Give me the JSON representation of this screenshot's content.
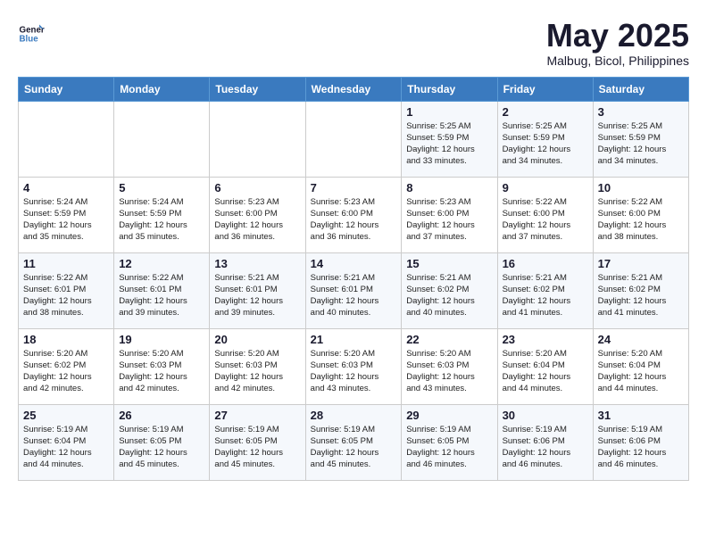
{
  "header": {
    "logo_line1": "General",
    "logo_line2": "Blue",
    "month": "May 2025",
    "location": "Malbug, Bicol, Philippines"
  },
  "days_of_week": [
    "Sunday",
    "Monday",
    "Tuesday",
    "Wednesday",
    "Thursday",
    "Friday",
    "Saturday"
  ],
  "weeks": [
    [
      {
        "day": "",
        "info": ""
      },
      {
        "day": "",
        "info": ""
      },
      {
        "day": "",
        "info": ""
      },
      {
        "day": "",
        "info": ""
      },
      {
        "day": "1",
        "info": "Sunrise: 5:25 AM\nSunset: 5:59 PM\nDaylight: 12 hours\nand 33 minutes."
      },
      {
        "day": "2",
        "info": "Sunrise: 5:25 AM\nSunset: 5:59 PM\nDaylight: 12 hours\nand 34 minutes."
      },
      {
        "day": "3",
        "info": "Sunrise: 5:25 AM\nSunset: 5:59 PM\nDaylight: 12 hours\nand 34 minutes."
      }
    ],
    [
      {
        "day": "4",
        "info": "Sunrise: 5:24 AM\nSunset: 5:59 PM\nDaylight: 12 hours\nand 35 minutes."
      },
      {
        "day": "5",
        "info": "Sunrise: 5:24 AM\nSunset: 5:59 PM\nDaylight: 12 hours\nand 35 minutes."
      },
      {
        "day": "6",
        "info": "Sunrise: 5:23 AM\nSunset: 6:00 PM\nDaylight: 12 hours\nand 36 minutes."
      },
      {
        "day": "7",
        "info": "Sunrise: 5:23 AM\nSunset: 6:00 PM\nDaylight: 12 hours\nand 36 minutes."
      },
      {
        "day": "8",
        "info": "Sunrise: 5:23 AM\nSunset: 6:00 PM\nDaylight: 12 hours\nand 37 minutes."
      },
      {
        "day": "9",
        "info": "Sunrise: 5:22 AM\nSunset: 6:00 PM\nDaylight: 12 hours\nand 37 minutes."
      },
      {
        "day": "10",
        "info": "Sunrise: 5:22 AM\nSunset: 6:00 PM\nDaylight: 12 hours\nand 38 minutes."
      }
    ],
    [
      {
        "day": "11",
        "info": "Sunrise: 5:22 AM\nSunset: 6:01 PM\nDaylight: 12 hours\nand 38 minutes."
      },
      {
        "day": "12",
        "info": "Sunrise: 5:22 AM\nSunset: 6:01 PM\nDaylight: 12 hours\nand 39 minutes."
      },
      {
        "day": "13",
        "info": "Sunrise: 5:21 AM\nSunset: 6:01 PM\nDaylight: 12 hours\nand 39 minutes."
      },
      {
        "day": "14",
        "info": "Sunrise: 5:21 AM\nSunset: 6:01 PM\nDaylight: 12 hours\nand 40 minutes."
      },
      {
        "day": "15",
        "info": "Sunrise: 5:21 AM\nSunset: 6:02 PM\nDaylight: 12 hours\nand 40 minutes."
      },
      {
        "day": "16",
        "info": "Sunrise: 5:21 AM\nSunset: 6:02 PM\nDaylight: 12 hours\nand 41 minutes."
      },
      {
        "day": "17",
        "info": "Sunrise: 5:21 AM\nSunset: 6:02 PM\nDaylight: 12 hours\nand 41 minutes."
      }
    ],
    [
      {
        "day": "18",
        "info": "Sunrise: 5:20 AM\nSunset: 6:02 PM\nDaylight: 12 hours\nand 42 minutes."
      },
      {
        "day": "19",
        "info": "Sunrise: 5:20 AM\nSunset: 6:03 PM\nDaylight: 12 hours\nand 42 minutes."
      },
      {
        "day": "20",
        "info": "Sunrise: 5:20 AM\nSunset: 6:03 PM\nDaylight: 12 hours\nand 42 minutes."
      },
      {
        "day": "21",
        "info": "Sunrise: 5:20 AM\nSunset: 6:03 PM\nDaylight: 12 hours\nand 43 minutes."
      },
      {
        "day": "22",
        "info": "Sunrise: 5:20 AM\nSunset: 6:03 PM\nDaylight: 12 hours\nand 43 minutes."
      },
      {
        "day": "23",
        "info": "Sunrise: 5:20 AM\nSunset: 6:04 PM\nDaylight: 12 hours\nand 44 minutes."
      },
      {
        "day": "24",
        "info": "Sunrise: 5:20 AM\nSunset: 6:04 PM\nDaylight: 12 hours\nand 44 minutes."
      }
    ],
    [
      {
        "day": "25",
        "info": "Sunrise: 5:19 AM\nSunset: 6:04 PM\nDaylight: 12 hours\nand 44 minutes."
      },
      {
        "day": "26",
        "info": "Sunrise: 5:19 AM\nSunset: 6:05 PM\nDaylight: 12 hours\nand 45 minutes."
      },
      {
        "day": "27",
        "info": "Sunrise: 5:19 AM\nSunset: 6:05 PM\nDaylight: 12 hours\nand 45 minutes."
      },
      {
        "day": "28",
        "info": "Sunrise: 5:19 AM\nSunset: 6:05 PM\nDaylight: 12 hours\nand 45 minutes."
      },
      {
        "day": "29",
        "info": "Sunrise: 5:19 AM\nSunset: 6:05 PM\nDaylight: 12 hours\nand 46 minutes."
      },
      {
        "day": "30",
        "info": "Sunrise: 5:19 AM\nSunset: 6:06 PM\nDaylight: 12 hours\nand 46 minutes."
      },
      {
        "day": "31",
        "info": "Sunrise: 5:19 AM\nSunset: 6:06 PM\nDaylight: 12 hours\nand 46 minutes."
      }
    ]
  ]
}
